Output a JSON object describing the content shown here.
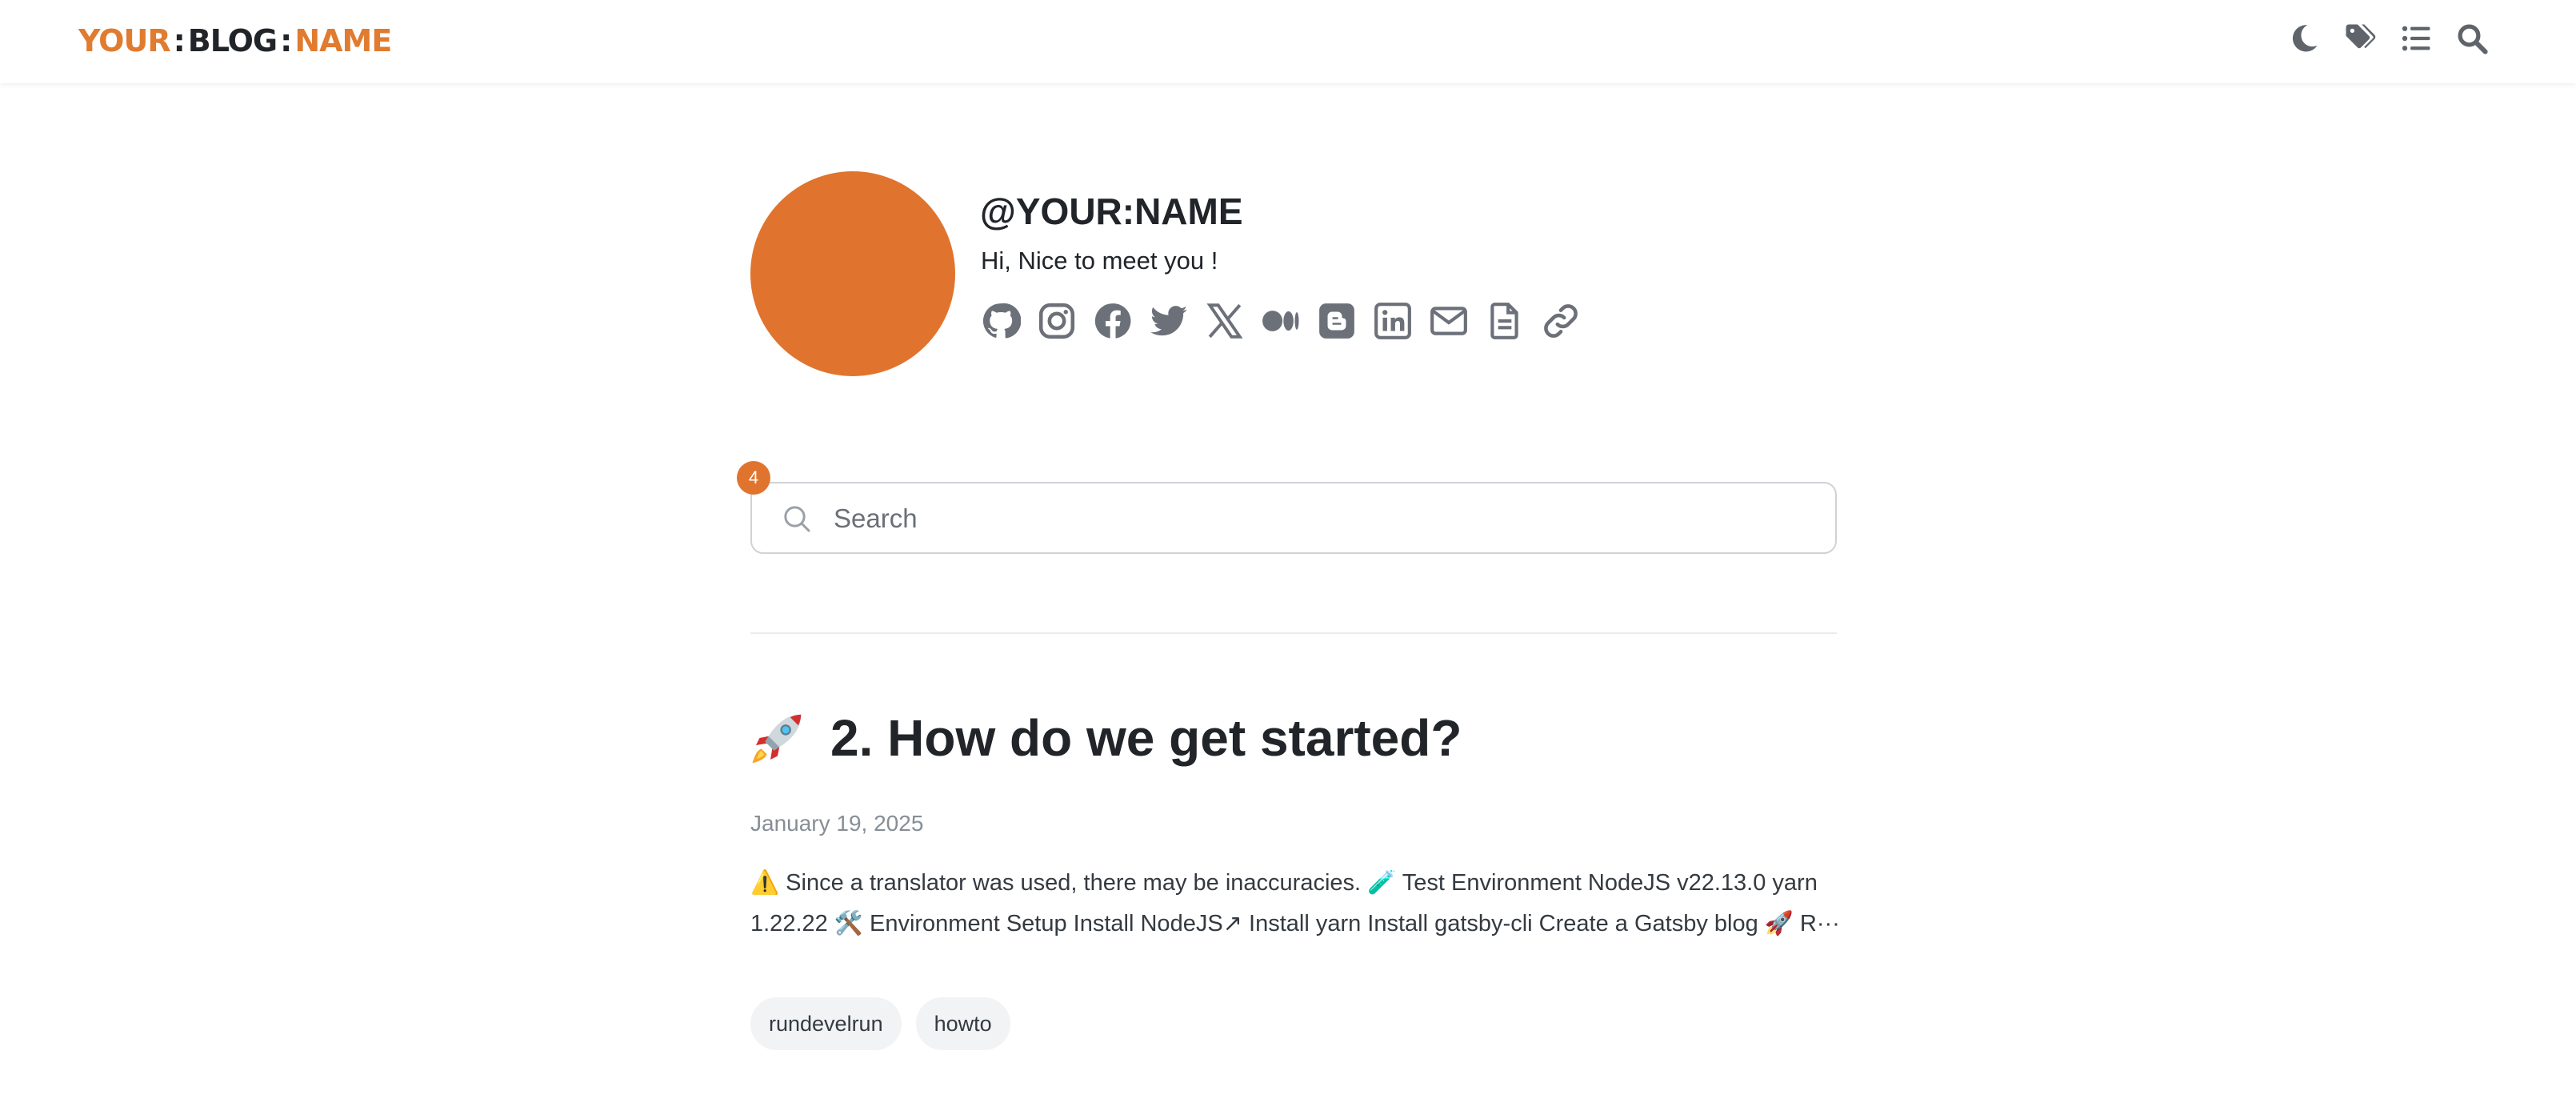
{
  "header": {
    "logo": {
      "part1": "YOUR",
      "sep": ":",
      "part2": "BLOG",
      "part3": "NAME"
    },
    "icons": [
      "moon-icon",
      "tags-icon",
      "list-icon",
      "search-icon"
    ]
  },
  "profile": {
    "username": "@YOUR:NAME",
    "bio": "Hi, Nice to meet you !",
    "avatar_color": "#e0742e",
    "socials": [
      "github-icon",
      "instagram-icon",
      "facebook-icon",
      "twitter-icon",
      "x-icon",
      "medium-icon",
      "blogger-icon",
      "linkedin-icon",
      "email-icon",
      "document-icon",
      "link-icon"
    ]
  },
  "search": {
    "placeholder": "Search",
    "count": "4"
  },
  "post": {
    "title": "2. How do we get started?",
    "date": "January 19, 2025",
    "excerpt": "⚠️ Since a translator was used, there may be inaccuracies. 🧪 Test Environment NodeJS v22.13.0 yarn 1.22.22 🛠️ Environment Setup Install NodeJS↗ Install yarn Install gatsby-cli Create a Gatsby blog 🚀 R···",
    "tags": [
      "rundevelrun",
      "howto"
    ]
  },
  "colors": {
    "accent": "#e07b2f",
    "text": "#212529",
    "muted": "#868e96"
  }
}
